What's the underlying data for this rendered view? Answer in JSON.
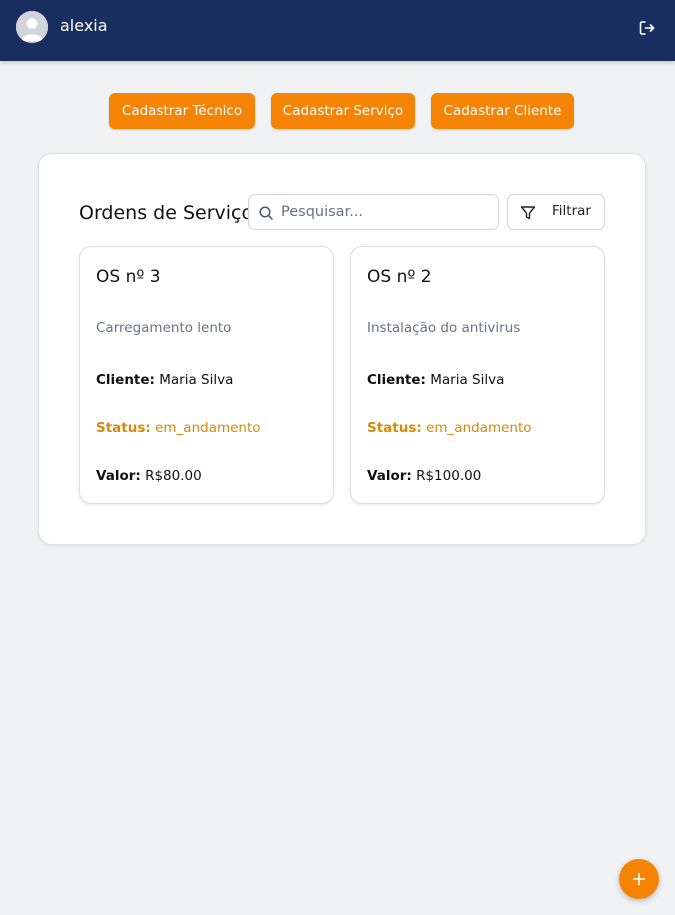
{
  "header": {
    "username": "alexia",
    "avatar_icon": "user-avatar-icon",
    "logout_icon": "logout-icon",
    "background": "#182e5e"
  },
  "actions": [
    {
      "label": "Cadastrar Técnico"
    },
    {
      "label": "Cadastrar Serviço"
    },
    {
      "label": "Cadastrar Cliente"
    }
  ],
  "panel": {
    "title": "Ordens de Serviço",
    "search_placeholder": "Pesquisar...",
    "search_value": "",
    "filter_label": "Filtrar"
  },
  "orders": [
    {
      "title": "OS nº 3",
      "description": "Carregamento lento",
      "client_label": "Cliente:",
      "client": "Maria Silva",
      "status_label": "Status:",
      "status": "em_andamento",
      "value_label": "Valor:",
      "value": "R$80.00"
    },
    {
      "title": "OS nº 2",
      "description": "Instalação do antivirus",
      "client_label": "Cliente:",
      "client": "Maria Silva",
      "status_label": "Status:",
      "status": "em_andamento",
      "value_label": "Valor:",
      "value": "R$100.00"
    }
  ],
  "fab": {
    "icon": "plus-icon"
  },
  "colors": {
    "accent": "#f58304",
    "status": "#d58a0a",
    "background": "#f1f2f4"
  }
}
